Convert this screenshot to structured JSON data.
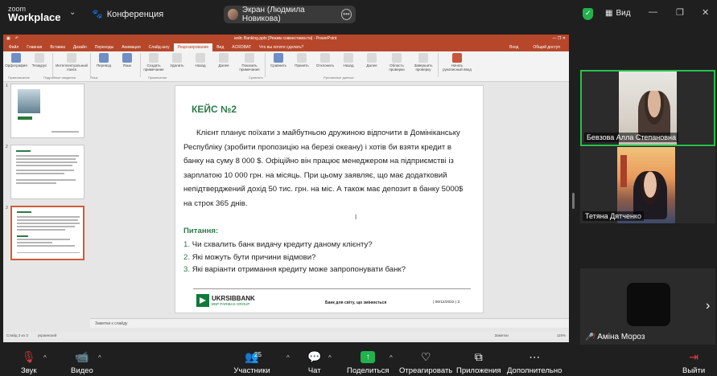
{
  "topbar": {
    "logo_small": "zoom",
    "logo_big": "Workplace",
    "meeting_label": "Конференция",
    "screen_share_label": "Экран (Людмила Новикова)",
    "view_label": "Вид"
  },
  "ppt": {
    "title": "кейс Banking.pptx [Режим совместимости] - PowerPoint",
    "tabs": [
      "Файл",
      "Главная",
      "Вставка",
      "Дизайн",
      "Переходы",
      "Анимация",
      "Слайд-шоу",
      "Рецензирование",
      "Вид",
      "ACROBAT",
      "Что вы хотите сделать?"
    ],
    "tabs_right": [
      "Вход",
      "Общий доступ"
    ],
    "ribbon_items": [
      "Орфография",
      "Тезаурус",
      "Интеллектуальный поиск",
      "Перевод",
      "Язык",
      "Создать примечание",
      "Удалить",
      "Назад",
      "Далее",
      "Показать примечания",
      "Сравнить",
      "Принять",
      "Отклонить",
      "Назад",
      "Далее",
      "Область проверки",
      "Завершить проверку",
      "Начать рукописный ввод"
    ],
    "ribbon_groups": [
      "Правописание",
      "Подробные сведения",
      "Язык",
      "Примечания",
      "Сравнить",
      "Рукописные данные"
    ],
    "thumb_numbers": [
      "1",
      "2",
      "3"
    ],
    "notes_placeholder": "Заметки к слайду",
    "status_left": "Слайд 3 из 3",
    "status_lang": "украинский",
    "status_right": "Заметки",
    "zoom_pct": "115%"
  },
  "slide": {
    "title": "КЕЙС №2",
    "body": "Клієнт планує поїхати з майбутньою дружиною відпочити в Домініканську Республіку (зробити пропозицію на березі океану) і хотів би взяти кредит в банку на суму 8 000 $. Офіційно він працює менеджером на підприємстві із зарплатою 10 000 грн. на місяць. При цьому заявляє, що має додатковий непідтверджений дохід 50 тис. грн. на міс. А також має депозит в банку 5000$ на строк 365 днів.",
    "questions_heading": "Питання:",
    "questions": [
      {
        "num": "1.",
        "text": "Чи схвалить банк видачу кредиту даному клієнту?"
      },
      {
        "num": "2.",
        "text": "Які можуть бути причини відмови?"
      },
      {
        "num": "3.",
        "text": "Які варіанти отримання кредиту може запропонувати банк?"
      }
    ],
    "logo_name": "UKRSIBBANK",
    "logo_sub": "BNP PARIBAS GROUP",
    "slogan": "Банк для світу, що змінюється",
    "date": "| 06/12/2022 |   3"
  },
  "participants": [
    {
      "name": "Бевзова Алла Степановна"
    },
    {
      "name": "Тетяна Дятченко"
    },
    {
      "name": "Аміна Мороз"
    }
  ],
  "toolbar": {
    "audio": "Звук",
    "video": "Видео",
    "participants": "Участники",
    "participants_count": "25",
    "chat": "Чат",
    "share": "Поделиться",
    "react": "Отреагировать",
    "apps": "Приложения",
    "more": "Дополнительно",
    "leave": "Выйти"
  },
  "colors": {
    "ppt_accent": "#b7472a",
    "slide_green": "#2e7a4a",
    "active_speaker": "#27c24c",
    "share_green": "#22b24c",
    "muted_red": "#e03a3a"
  }
}
